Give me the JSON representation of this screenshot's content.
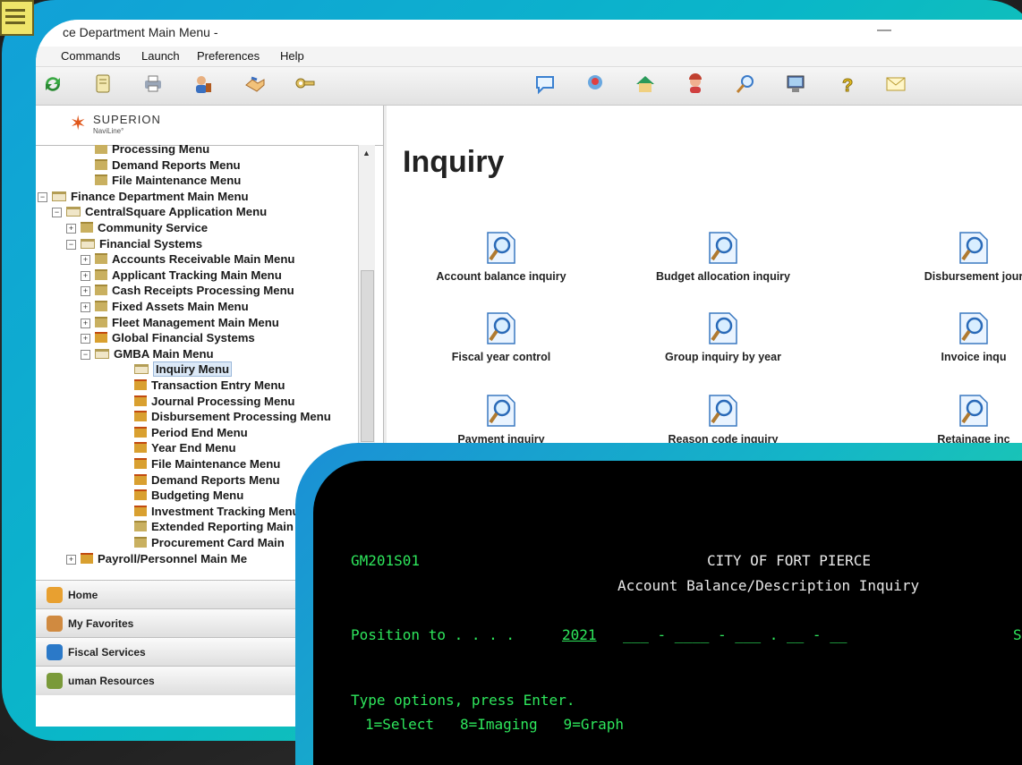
{
  "window": {
    "title": "ce Department Main Menu -",
    "minimize_glyph": "—"
  },
  "menubar": [
    "Commands",
    "Launch",
    "Preferences",
    "Help"
  ],
  "toolbar_icons": [
    "refresh-icon",
    "document-icon",
    "printer-icon",
    "user-tools-icon",
    "handshake-icon",
    "keys-icon",
    "chat-bubble-icon",
    "pin-icon",
    "house-icon",
    "person-icon",
    "search-icon",
    "computer-icon",
    "help-icon",
    "mail-icon"
  ],
  "logo": {
    "name": "SUPERION",
    "sub": "NaviLine°"
  },
  "tree": [
    {
      "label": "Processing Menu",
      "indent": 3,
      "type": "folder",
      "pm": ""
    },
    {
      "label": "Demand Reports Menu",
      "indent": 3,
      "type": "folder",
      "pm": ""
    },
    {
      "label": "File Maintenance Menu",
      "indent": 3,
      "type": "folder",
      "pm": ""
    },
    {
      "label": "Finance Department Main Menu",
      "indent": 0,
      "type": "open",
      "pm": "−"
    },
    {
      "label": "CentralSquare Application Menu",
      "indent": 1,
      "type": "open",
      "pm": "−"
    },
    {
      "label": "Community Service",
      "indent": 2,
      "type": "folder",
      "pm": "+"
    },
    {
      "label": "Financial Systems",
      "indent": 2,
      "type": "open",
      "pm": "−"
    },
    {
      "label": "Accounts Receivable Main Menu",
      "indent": 3,
      "type": "folder",
      "pm": "+"
    },
    {
      "label": "Applicant Tracking Main Menu",
      "indent": 3,
      "type": "folder",
      "pm": "+"
    },
    {
      "label": "Cash Receipts Processing Menu",
      "indent": 3,
      "type": "folder",
      "pm": "+"
    },
    {
      "label": "Fixed Assets Main Menu",
      "indent": 3,
      "type": "folder",
      "pm": "+"
    },
    {
      "label": "Fleet Management Main Menu",
      "indent": 3,
      "type": "folder",
      "pm": "+"
    },
    {
      "label": "Global Financial Systems",
      "indent": 3,
      "type": "red",
      "pm": "+"
    },
    {
      "label": "GMBA Main Menu",
      "indent": 3,
      "type": "open",
      "pm": "−"
    },
    {
      "label": "Inquiry Menu",
      "indent": 4,
      "type": "open",
      "pm": "",
      "selected": true
    },
    {
      "label": "Transaction Entry Menu",
      "indent": 4,
      "type": "red",
      "pm": ""
    },
    {
      "label": "Journal Processing Menu",
      "indent": 4,
      "type": "red",
      "pm": ""
    },
    {
      "label": "Disbursement Processing Menu",
      "indent": 4,
      "type": "red",
      "pm": ""
    },
    {
      "label": "Period End Menu",
      "indent": 4,
      "type": "red",
      "pm": ""
    },
    {
      "label": "Year End Menu",
      "indent": 4,
      "type": "red",
      "pm": ""
    },
    {
      "label": "File Maintenance Menu",
      "indent": 4,
      "type": "red",
      "pm": ""
    },
    {
      "label": "Demand Reports Menu",
      "indent": 4,
      "type": "red",
      "pm": ""
    },
    {
      "label": "Budgeting Menu",
      "indent": 4,
      "type": "red",
      "pm": ""
    },
    {
      "label": "Investment Tracking Menu",
      "indent": 4,
      "type": "red",
      "pm": ""
    },
    {
      "label": "Extended Reporting Main",
      "indent": 4,
      "type": "folder",
      "pm": ""
    },
    {
      "label": "Procurement Card Main",
      "indent": 4,
      "type": "folder",
      "pm": ""
    },
    {
      "label": "Payroll/Personnel Main Me",
      "indent": 2,
      "type": "red",
      "pm": "+"
    }
  ],
  "accordion": [
    {
      "label": "Home",
      "icon": "home-icon",
      "color": "#e8a030"
    },
    {
      "label": "My Favorites",
      "icon": "favorites-icon",
      "color": "#d08a40"
    },
    {
      "label": "Fiscal Services",
      "icon": "fiscal-services-icon",
      "color": "#2b79c8"
    },
    {
      "label": "uman Resources",
      "icon": "human-resources-icon",
      "color": "#7a9a3a"
    }
  ],
  "inquiry": {
    "heading": "Inquiry",
    "items": [
      "Account balance inquiry",
      "Budget allocation inquiry",
      "Disbursement jour",
      "Fiscal year control",
      "Group inquiry by year",
      "Invoice inqu",
      "Payment inquiry",
      "Reason code inquiry",
      "Retainage inc"
    ]
  },
  "terminal": {
    "program": "GM201S01",
    "city": "CITY OF FORT PIERCE",
    "screen_title": "Account Balance/Description Inquiry",
    "position_label": "Position to . . . .",
    "year": "2021",
    "fields": "___ - ____ - ___ . __ - __",
    "status_cut": "Sta",
    "instructions": "Type options, press Enter.",
    "options": "1=Select   8=Imaging   9=Graph"
  }
}
